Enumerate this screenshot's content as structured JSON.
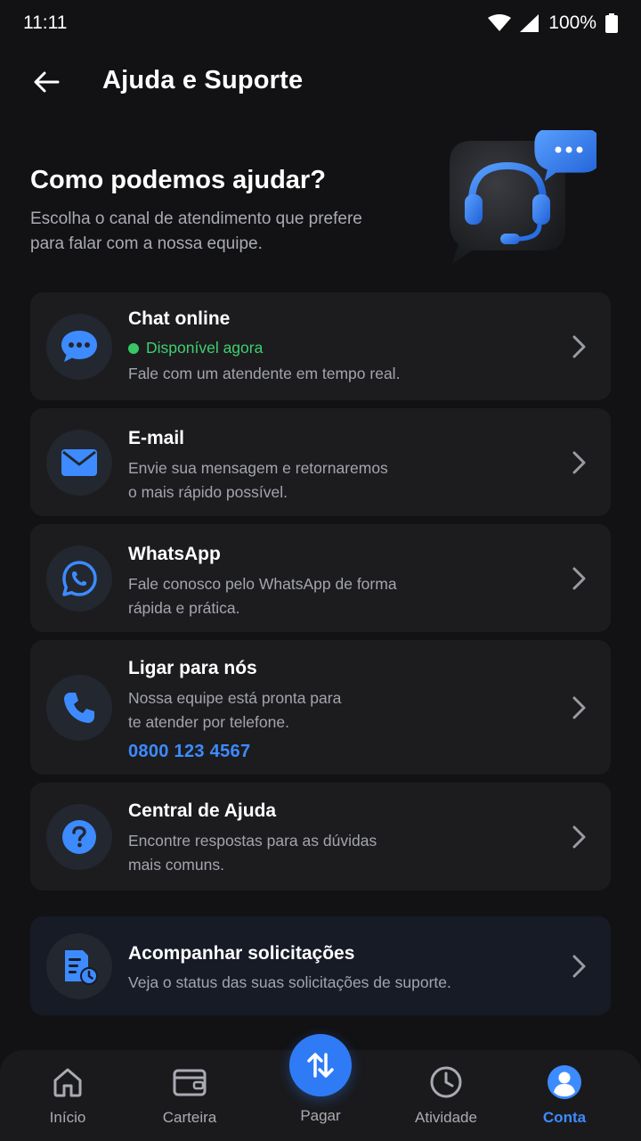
{
  "status_bar": {
    "time": "11:11",
    "battery": "100%"
  },
  "app_bar": {
    "title": "Ajuda e Suporte"
  },
  "hero": {
    "title": "Como podemos ajudar?",
    "subtitle": "Escolha o canal de atendimento que prefere para falar com a nossa equipe."
  },
  "options": {
    "chat": {
      "title": "Chat online",
      "status": "Disponível agora",
      "desc": "Fale com um atendente em tempo real."
    },
    "email": {
      "title": "E-mail",
      "desc_1": "Envie sua mensagem e retornaremos",
      "desc_2": "o mais rápido possível."
    },
    "whatsapp": {
      "title": "WhatsApp",
      "desc_1": "Fale conosco pelo WhatsApp de forma",
      "desc_2": "rápida e prática."
    },
    "phone": {
      "title": "Ligar para nós",
      "desc_1": "Nossa equipe está pronta para",
      "desc_2": "te atender por telefone.",
      "number": "0800 123 4567"
    },
    "help_center": {
      "title": "Central de Ajuda",
      "desc_1": "Encontre respostas para as dúvidas",
      "desc_2": "mais comuns."
    },
    "track": {
      "title": "Acompanhar solicitações",
      "desc": "Veja o status das suas solicitações de suporte."
    }
  },
  "bottom_nav": {
    "home": "Início",
    "wallet": "Carteira",
    "pay": "Pagar",
    "activity": "Atividade",
    "account": "Conta"
  },
  "colors": {
    "background": "#121214",
    "card": "#1c1c1f",
    "accent": "#3d8bff",
    "available": "#3fcf6e"
  }
}
